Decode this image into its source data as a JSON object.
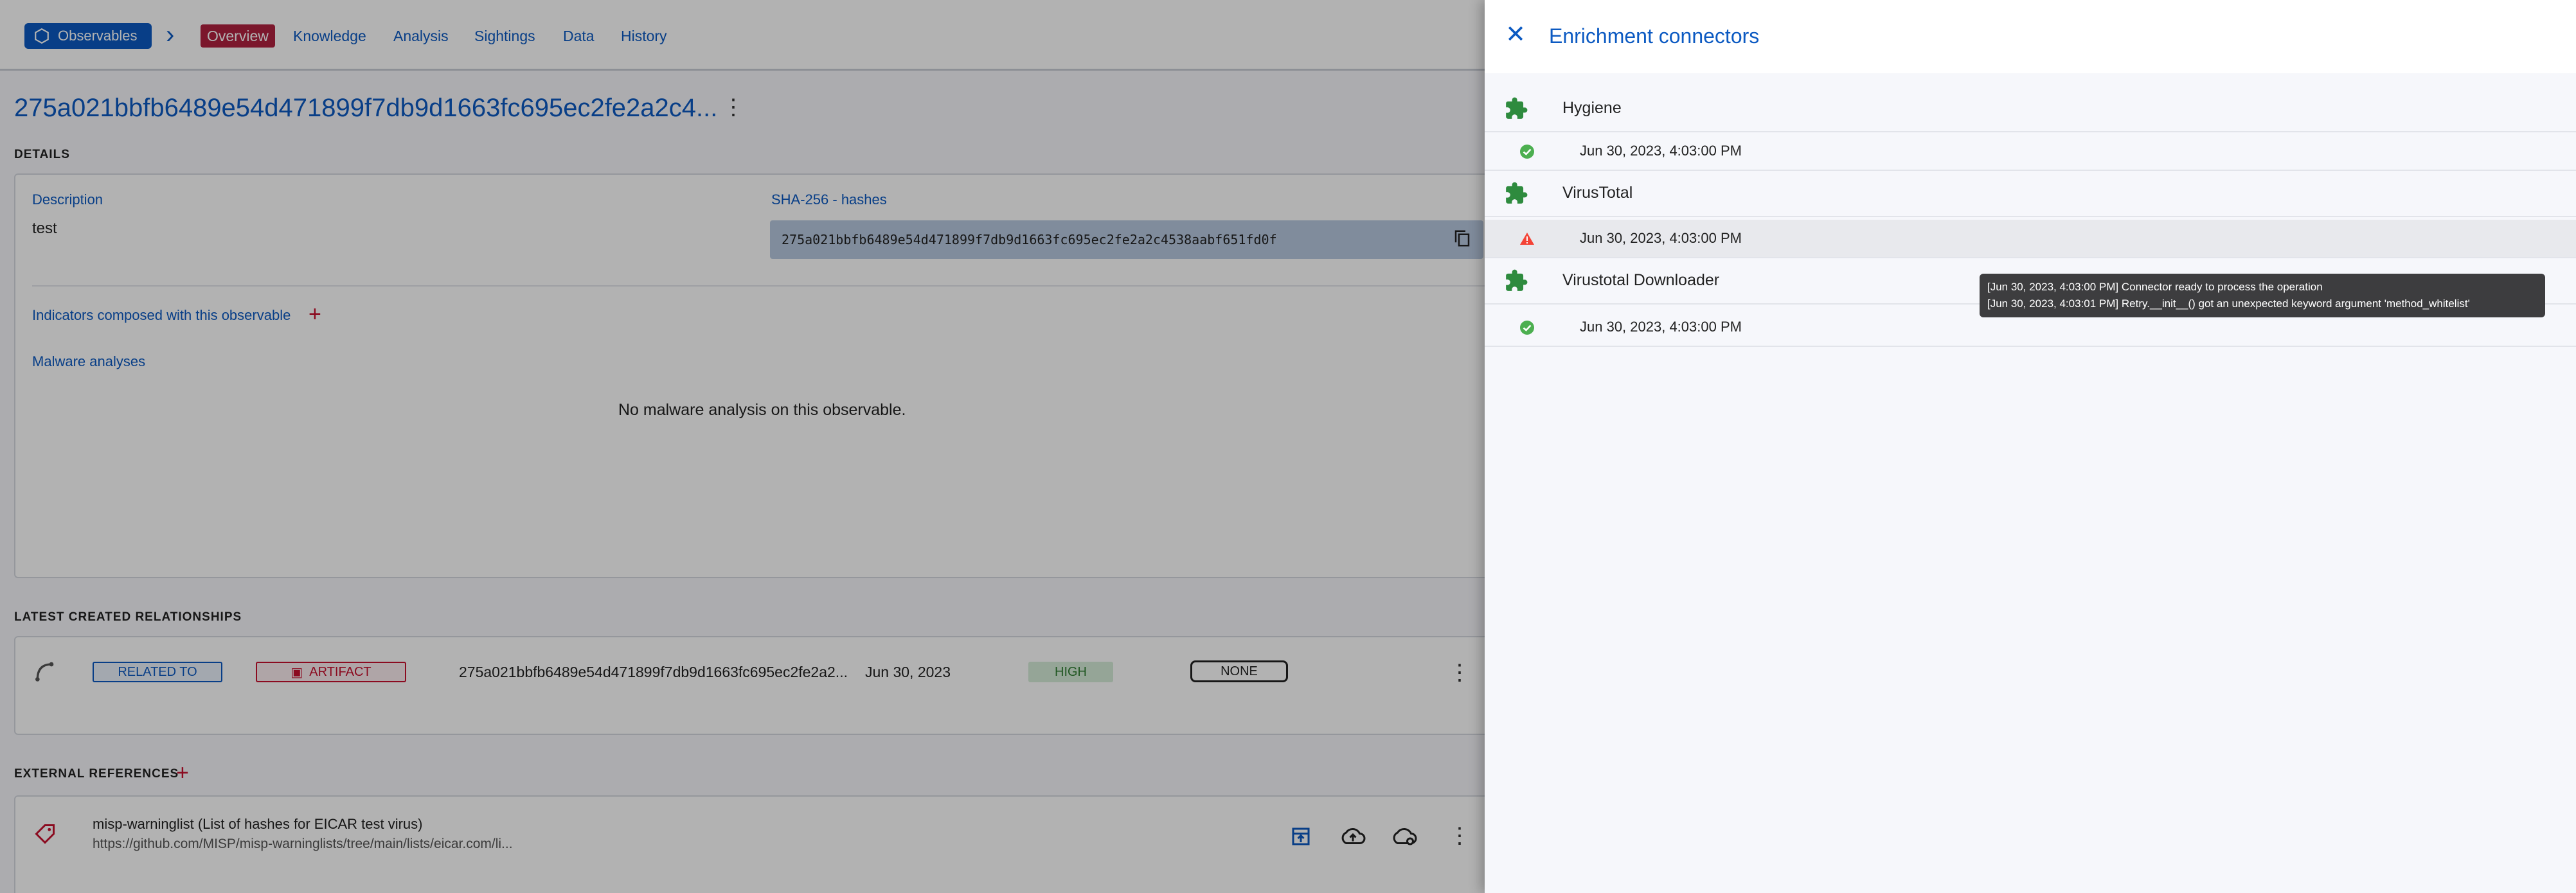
{
  "nav": {
    "observables_label": "Observables",
    "tabs": [
      "Overview",
      "Knowledge",
      "Analysis",
      "Sightings",
      "Data",
      "History"
    ]
  },
  "entity": {
    "title": "275a021bbfb6489e54d471899f7db9d1663fc695ec2fe2a2c4...",
    "details_label": "DETAILS",
    "description_label": "Description",
    "description_value": "test",
    "hash_label": "SHA-256 - hashes",
    "hash_value": "275a021bbfb6489e54d471899f7db9d1663fc695ec2fe2a2c4538aabf651fd0f",
    "indicators_label": "Indicators composed with this observable",
    "malware_label": "Malware analyses",
    "malware_empty": "No malware analysis on this observable."
  },
  "relationships": {
    "label": "LATEST CREATED RELATIONSHIPS",
    "row": {
      "relation": "RELATED TO",
      "type": "ARTIFACT",
      "name": "275a021bbfb6489e54d471899f7db9d1663fc695ec2fe2a2...",
      "date": "Jun 30, 2023",
      "confidence": "HIGH",
      "marking": "NONE"
    }
  },
  "external_refs": {
    "label": "EXTERNAL REFERENCES",
    "item": {
      "title": "misp-warninglist (List of hashes for EICAR test virus)",
      "url": "https://github.com/MISP/misp-warninglists/tree/main/lists/eicar.com/li..."
    }
  },
  "drawer": {
    "title": "Enrichment connectors",
    "connectors": [
      {
        "name": "Hygiene",
        "work_date": "Jun 30, 2023, 4:03:00 PM",
        "status": "success"
      },
      {
        "name": "VirusTotal",
        "work_date": "Jun 30, 2023, 4:03:00 PM",
        "status": "warning"
      },
      {
        "name": "Virustotal Downloader",
        "work_date": "Jun 30, 2023, 4:03:00 PM",
        "status": "success"
      }
    ],
    "tooltip": [
      "[Jun 30, 2023, 4:03:00 PM] Connector ready to process the operation",
      "[Jun 30, 2023, 4:03:01 PM] Retry.__init__() got an unexpected keyword argument 'method_whitelist'"
    ]
  },
  "colors": {
    "accent": "#0c5ac2",
    "active_tab": "#b0223f",
    "success": "#4caf50",
    "warning": "#f44336",
    "connector_icon": "#2e8b3e"
  }
}
